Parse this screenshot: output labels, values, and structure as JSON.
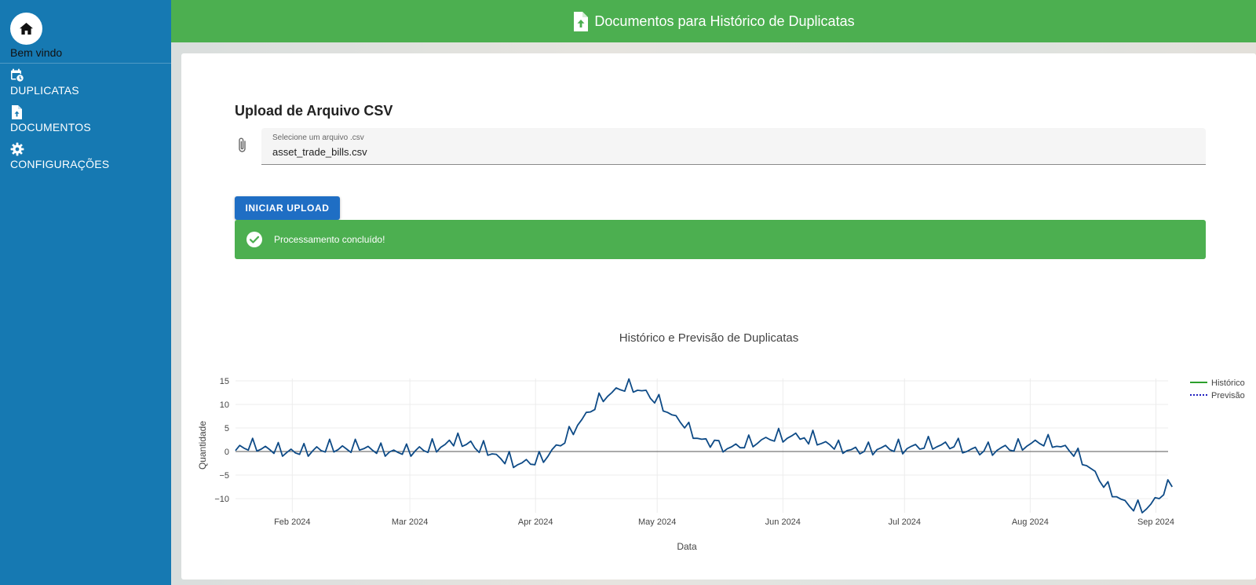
{
  "sidebar": {
    "welcome_label": "Bem vindo",
    "items": [
      {
        "label": "DUPLICATAS",
        "icon": "calendar-clock-icon"
      },
      {
        "label": "DOCUMENTOS",
        "icon": "file-upload-icon"
      },
      {
        "label": "CONFIGURAÇÕES",
        "icon": "gear-icon"
      }
    ]
  },
  "header": {
    "title": "Documentos para Histórico de Duplicatas",
    "icon": "file-upload-icon"
  },
  "upload": {
    "title": "Upload de Arquivo CSV",
    "file_field_label": "Selecione um arquivo .csv",
    "file_field_value": "asset_trade_bills.csv",
    "button_label": "INICIAR UPLOAD",
    "alert_text": "Processamento concluído!"
  },
  "colors": {
    "sidebar": "#1679b2",
    "header": "#4caf50",
    "button": "#1f6ec4",
    "series_line": "#0d4a86"
  },
  "chart_data": {
    "type": "line",
    "title": "Histórico e Previsão de Duplicatas",
    "xlabel": "Data",
    "ylabel": "Quantidade",
    "x_start": "2024-01-18",
    "x_end": "2024-09-05",
    "xlim": [
      "2024-01-18",
      "2024-09-04"
    ],
    "ylim": [
      -13,
      15.5
    ],
    "x_ticks": [
      "Feb 2024",
      "Mar 2024",
      "Apr 2024",
      "May 2024",
      "Jun 2024",
      "Jul 2024",
      "Aug 2024",
      "Sep 2024"
    ],
    "y_ticks": [
      15,
      10,
      5,
      0,
      -5,
      -10
    ],
    "zero_line": true,
    "grid": true,
    "legend_position": "top-right",
    "series": [
      {
        "name": "Histórico",
        "color": "#2ca02c",
        "style": "solid",
        "values": [
          0.2,
          1.3,
          0.7,
          0.3,
          2.8,
          0.1,
          0.5,
          1.1,
          0.4,
          -0.4,
          1.9,
          -1,
          -0.2,
          0.5,
          -0.3,
          -0.6,
          1.7,
          -1,
          0.1,
          1,
          0.2,
          -0.1,
          2.6,
          -0.1,
          0.4,
          1.2,
          0.5,
          -0.2,
          2.6,
          0.3,
          0.6,
          1.1,
          0.3,
          -0.4,
          1.8,
          -1,
          -0.1,
          0.3,
          -0.2,
          -0.6,
          1.6,
          -1,
          0.1,
          1,
          0.2,
          -0.2,
          2.7,
          -0.1,
          0.9,
          1.5,
          2.4,
          1.2,
          3.9,
          1.1,
          1.5,
          2.2,
          0.7,
          -0.2,
          2.3,
          -0.8,
          -0.5,
          -0.6,
          -1.5,
          -2.6,
          0,
          -3.4,
          -2.8,
          -2.4,
          -1.7,
          -2.7,
          -2.8,
          0,
          -2.3,
          -1.1,
          0.4,
          1.4,
          1.2,
          1.8,
          5.3,
          3.6,
          5.6,
          6.8,
          8.3,
          8.4,
          8.9,
          12.4,
          10.6,
          11.7,
          12.5,
          13.5,
          13.1,
          12.8,
          15.4,
          12.6,
          13,
          12.9,
          13,
          11.3,
          10.3,
          12.1,
          8.6,
          8.3,
          7.8,
          7.6,
          6.2,
          5,
          6.2,
          2.8,
          2.8,
          2.6,
          2.7,
          0.9,
          2.4,
          2.3,
          -0.1,
          0.6,
          1,
          1.6,
          0.8,
          0.8,
          3.5,
          1,
          1.7,
          2.5,
          3,
          2.5,
          2.2,
          4.9,
          2,
          2.8,
          3.3,
          3.9,
          2.6,
          2.9,
          1.6,
          4.5,
          1.4,
          1.7,
          2.1,
          1.4,
          0.5,
          2.4,
          -0.4,
          0.2,
          0.4,
          0.9,
          -0.5,
          0,
          2,
          -0.7,
          0.4,
          0.8,
          1.3,
          0.4,
          0,
          2.6,
          -0.5,
          0.6,
          1.1,
          1.5,
          0.5,
          0.7,
          3.2,
          0.5,
          1,
          1.4,
          2,
          0.6,
          1,
          2.8,
          -0.3,
          0,
          0.5,
          0.9,
          -0.7,
          0.1,
          2,
          -0.8,
          0.2,
          0.8,
          1.3,
          0.3,
          0.1,
          2.7,
          0.3,
          1.1,
          1.7,
          2.4,
          1.7,
          1.2,
          3.6,
          0.9,
          1.1,
          1,
          1.3,
          0.1,
          -1,
          0.7,
          -2.8,
          -3,
          -3.6,
          -4.2,
          -6.2,
          -7.6,
          -6.4,
          -9.6,
          -9.6,
          -10.1,
          -10.4,
          -11.6,
          -12.6,
          -10.3,
          -13,
          -12.2,
          -11.2,
          -9.8,
          -10,
          -9.2,
          -6,
          -7.5
        ]
      },
      {
        "name": "Previsão",
        "color": "#1f1fbf",
        "style": "dotted",
        "values": []
      }
    ]
  }
}
